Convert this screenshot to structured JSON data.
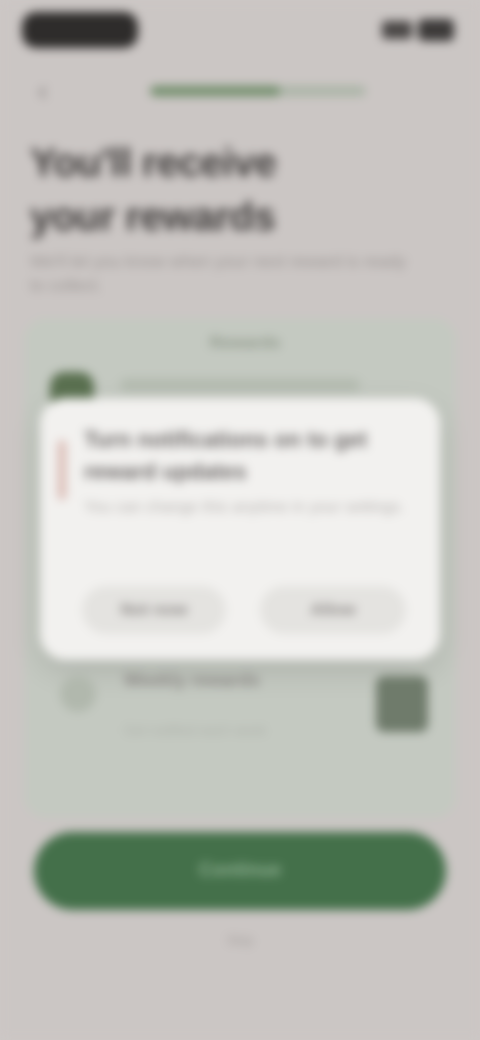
{
  "status_bar": {
    "time": "12:45"
  },
  "nav": {
    "progress": 0.6
  },
  "heading": {
    "title": "You'll receive your rewards",
    "subtitle": "We'll let you know when your next reward is ready to collect."
  },
  "card": {
    "label": "Rewards",
    "line": "Earn points with every purchase"
  },
  "dialog": {
    "title": "Turn notifications on to get reward updates",
    "body": "You can change this anytime in your settings.",
    "cancel_label": "Not now",
    "ok_label": "Allow"
  },
  "item": {
    "title": "Weekly rewards",
    "subtitle": "Get notified each week"
  },
  "cta": {
    "label": "Continue"
  },
  "footer": {
    "link": "Skip"
  },
  "colors": {
    "accent": "#44704a",
    "background": "#cbc6c4",
    "dialog": "#f2f1ef"
  }
}
